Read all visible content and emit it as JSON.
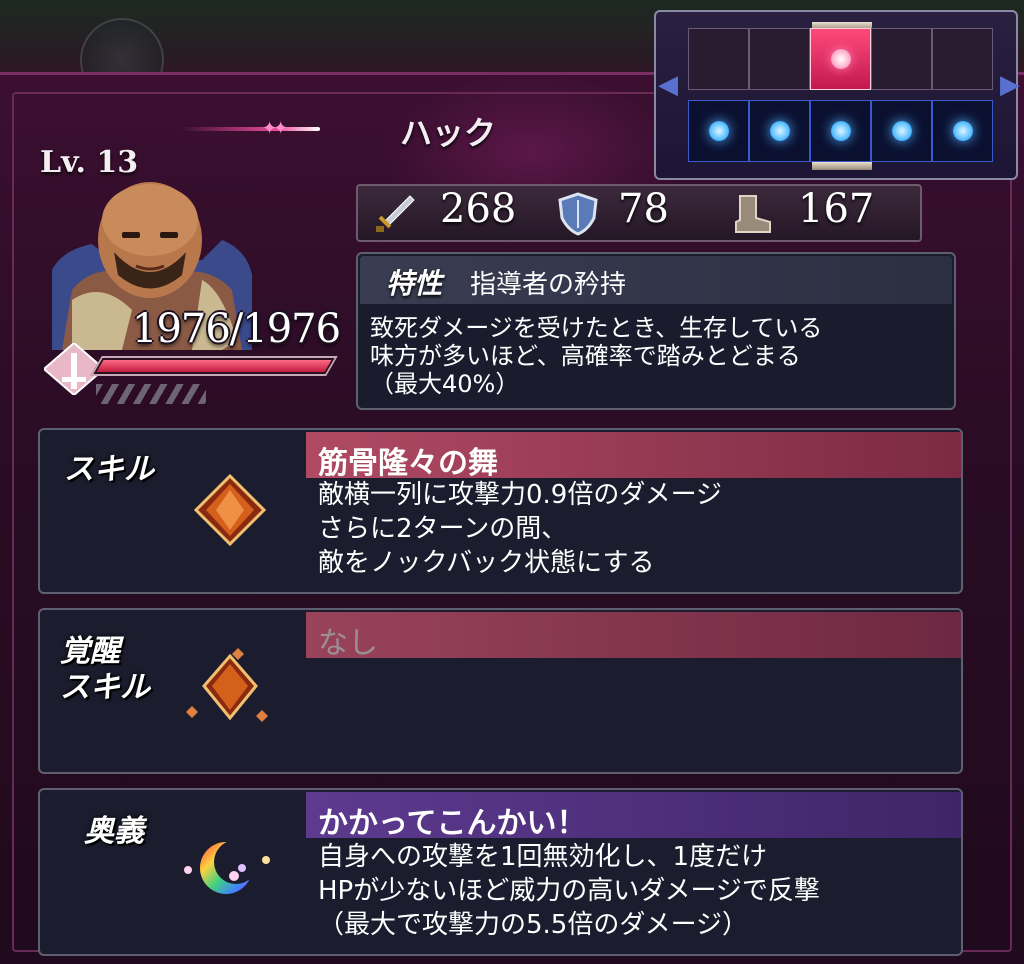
{
  "unit": {
    "name": "ハック",
    "level": "Lv. 13",
    "hp": "1976/1976",
    "hp_fraction": 1.0
  },
  "stats": {
    "attack": "268",
    "defense": "78",
    "move": "167"
  },
  "trait": {
    "label": "特性",
    "name": "指導者の矜持",
    "description": "致死ダメージを受けたとき、生存している\n味方が多いほど、高確率で踏みとどまる\n（最大40%）"
  },
  "skill": {
    "label": "スキル",
    "name": "筋骨隆々の舞",
    "description": "敵横一列に攻撃力0.9倍のダメージ\nさらに2ターンの間、\n敵をノックバック状態にする"
  },
  "awakening_skill": {
    "label": "覚醒\nスキル",
    "name": "なし",
    "description": ""
  },
  "ultimate": {
    "label": "奥義",
    "name": "かかってこんかい！",
    "description": "自身への攻撃を1回無効化し、1度だけ\nHPが少ないほど威力の高いダメージで反撃\n（最大で攻撃力の5.5倍のダメージ）"
  },
  "formation": {
    "enemy_row": [
      false,
      false,
      true,
      false,
      false
    ],
    "ally_row": [
      true,
      true,
      true,
      true,
      true
    ]
  },
  "colors": {
    "panel": "#2a0c24",
    "skill_header": "#b04a63",
    "ultimate_header": "#5d3a8f",
    "hp_bar": "#c21c40"
  }
}
